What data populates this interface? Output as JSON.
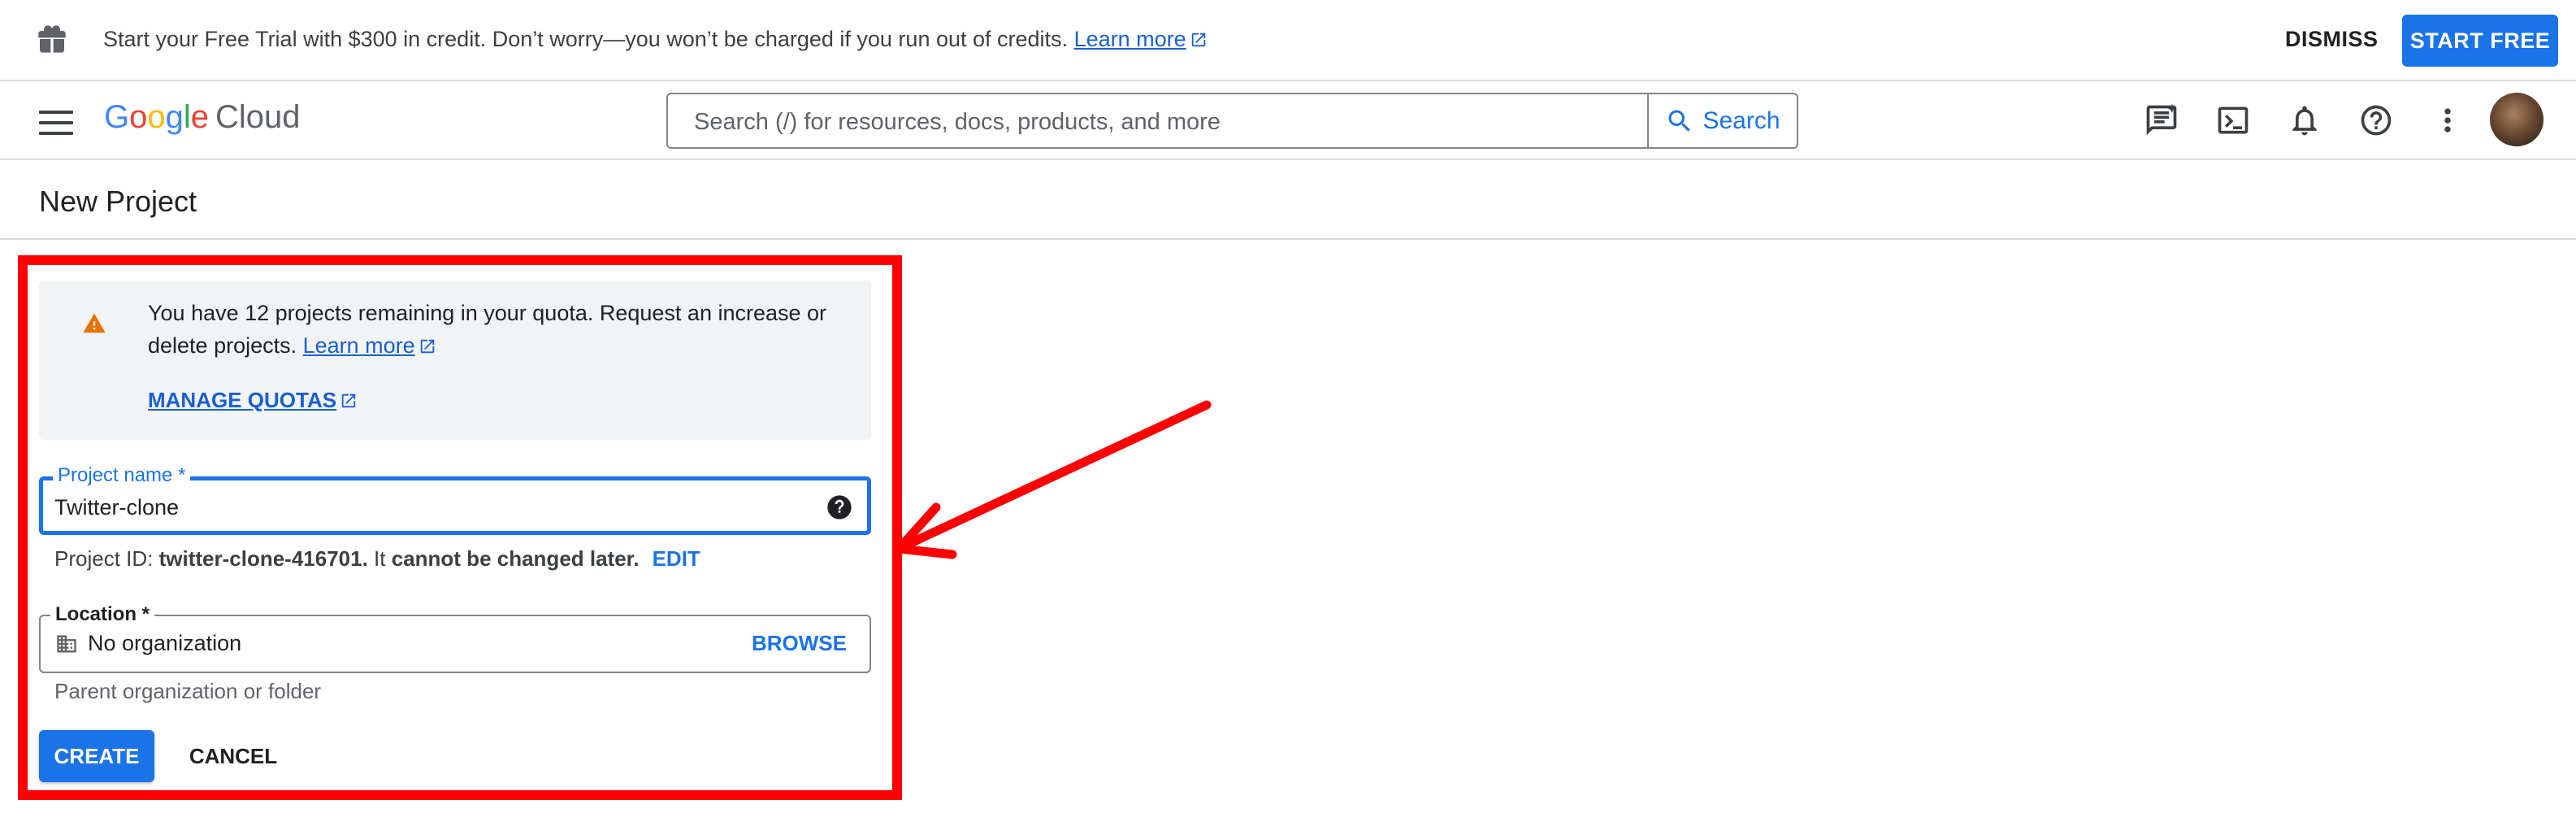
{
  "promo": {
    "text": "Start your Free Trial with $300 in credit. Don’t worry—you won’t be charged if you run out of credits.",
    "link": "Learn more",
    "dismiss": "DISMISS",
    "start_free": "START FREE"
  },
  "header": {
    "logo_g": [
      "G",
      "o",
      "o",
      "g",
      "l",
      "e"
    ],
    "logo_product": "Cloud",
    "search_placeholder": "Search (/) for resources, docs, products, and more",
    "search_button": "Search",
    "icons": [
      "ai-chat-icon",
      "cloud-shell-icon",
      "notifications-icon",
      "help-icon",
      "more-vert-icon"
    ]
  },
  "page": {
    "title": "New Project"
  },
  "notice": {
    "message": "You have 12 projects remaining in your quota. Request an increase or delete projects.",
    "learn_more": "Learn more",
    "manage_quotas": "MANAGE QUOTAS"
  },
  "form": {
    "project_name_label": "Project name *",
    "project_name_value": "Twitter-clone",
    "project_id_prefix": "Project ID:",
    "project_id_value": "twitter-clone-416701.",
    "project_id_mid": " It ",
    "project_id_warning": "cannot be changed later.",
    "edit": "EDIT",
    "location_label": "Location *",
    "location_value": "No organization",
    "browse": "BROWSE",
    "location_helper": "Parent organization or folder",
    "create": "CREATE",
    "cancel": "CANCEL"
  },
  "colors": {
    "accent": "#1a73e8",
    "annotation": "#ff0000",
    "warning": "#e37400"
  }
}
